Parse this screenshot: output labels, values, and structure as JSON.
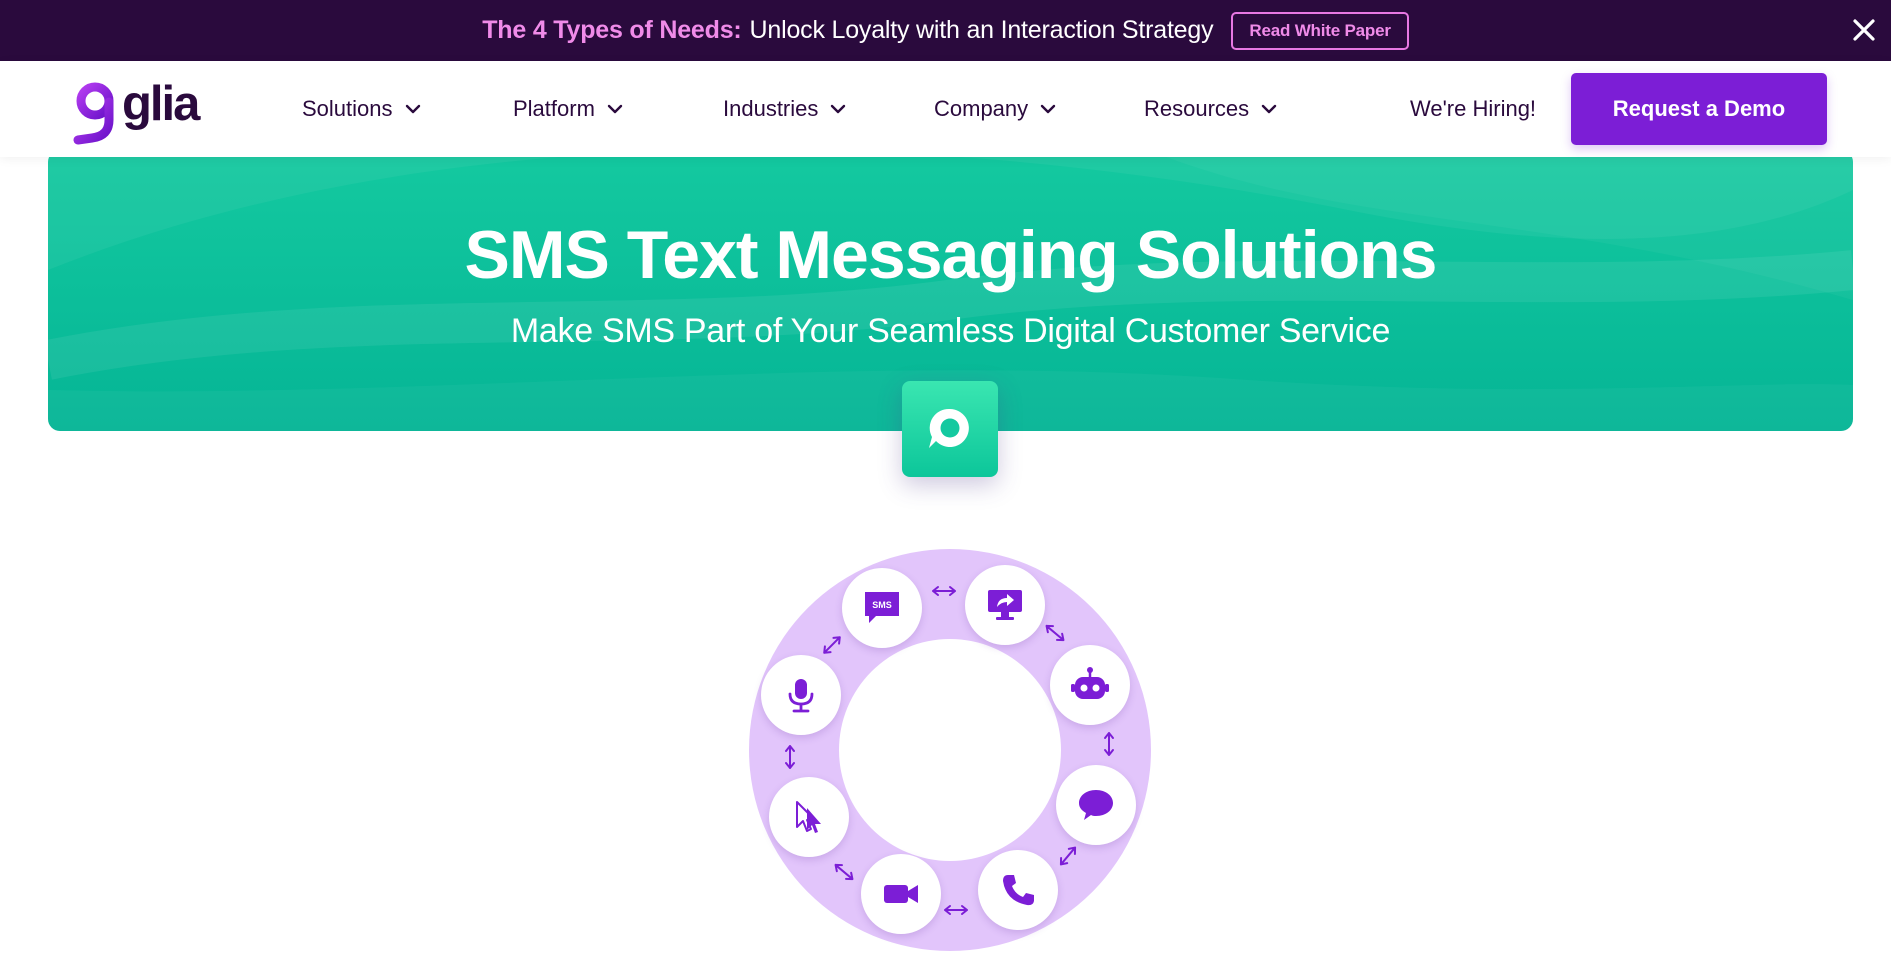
{
  "announcement": {
    "highlight": "The 4 Types of Needs:",
    "text": "Unlock Loyalty with an Interaction Strategy",
    "button_label": "Read White Paper",
    "close_icon": "close-icon"
  },
  "nav": {
    "logo_text": "glia",
    "items": [
      {
        "label": "Solutions"
      },
      {
        "label": "Platform"
      },
      {
        "label": "Industries"
      },
      {
        "label": "Company"
      },
      {
        "label": "Resources"
      }
    ],
    "hiring_label": "We're Hiring!",
    "demo_label": "Request a Demo"
  },
  "hero": {
    "title": "SMS Text Messaging Solutions",
    "subtitle": "Make SMS Part of Your Seamless Digital Customer Service",
    "badge_icon": "chat-bubble-icon"
  },
  "wheel": {
    "sms_icon_text": "SMS",
    "channels": [
      "sms-icon",
      "screen-share-icon",
      "robot-icon",
      "chat-icon",
      "phone-icon",
      "video-icon",
      "cursor-icon",
      "microphone-icon"
    ]
  },
  "colors": {
    "announcement_bg": "#2a0a3d",
    "highlight": "#f08be9",
    "brand_purple": "#7c1ed6",
    "hero_green": "#0bbd98",
    "wheel_lavender": "#e2c5fb"
  }
}
